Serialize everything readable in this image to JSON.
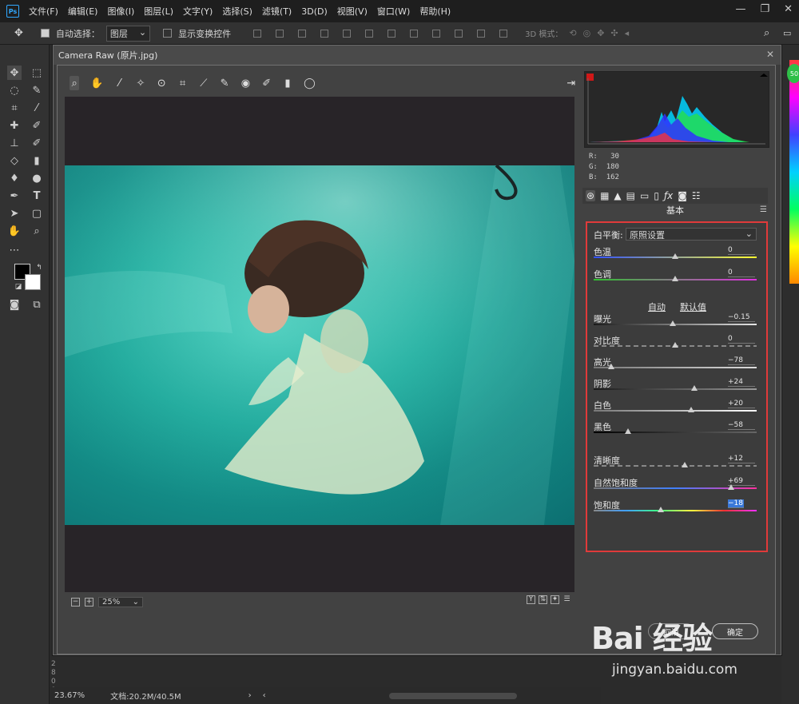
{
  "menubar": {
    "logo": "Ps",
    "items": [
      "文件(F)",
      "编辑(E)",
      "图像(I)",
      "图层(L)",
      "文字(Y)",
      "选择(S)",
      "滤镜(T)",
      "3D(D)",
      "视图(V)",
      "窗口(W)",
      "帮助(H)"
    ],
    "win_ctrls": [
      "—",
      "❐",
      "✕"
    ]
  },
  "options": {
    "auto_select_label": "自动选择：",
    "auto_select_value": "图层",
    "show_transform_label": "显示变换控件",
    "mode_3d_label": "3D 模式："
  },
  "dialog": {
    "title": "Camera Raw (原片.jpg)",
    "close": "✕"
  },
  "zoom": {
    "value": "25%"
  },
  "rgb": {
    "r_label": "R:",
    "r": "30",
    "g_label": "G:",
    "g": "180",
    "b_label": "B:",
    "b": "162"
  },
  "panel": {
    "title": "基本",
    "wb_label": "白平衡:",
    "wb_value": "原照设置",
    "auto": "自动",
    "default": "默认值"
  },
  "sliders": [
    {
      "label": "色温",
      "value": "0",
      "level": 0.5
    },
    {
      "label": "色调",
      "value": "0",
      "level": 0.5
    },
    {
      "label": "曝光",
      "value": "−0.15",
      "level": 0.485
    },
    {
      "label": "对比度",
      "value": "0",
      "level": 0.5
    },
    {
      "label": "高光",
      "value": "−78",
      "level": 0.11
    },
    {
      "label": "阴影",
      "value": "+24",
      "level": 0.62
    },
    {
      "label": "白色",
      "value": "+20",
      "level": 0.6
    },
    {
      "label": "黑色",
      "value": "−58",
      "level": 0.21
    },
    {
      "label": "清晰度",
      "value": "+12",
      "level": 0.56
    },
    {
      "label": "自然饱和度",
      "value": "+69",
      "level": 0.845
    },
    {
      "label": "饱和度",
      "value": "−18",
      "level": 0.41
    }
  ],
  "buttons": {
    "cancel": "取消",
    "ok": "确定"
  },
  "status": {
    "zoom": "23.67%",
    "doc": "文档:20.2M/40.5M"
  },
  "pagenums": [
    "2",
    "8",
    "0",
    "0"
  ],
  "watermark": {
    "main": "Bai 经验",
    "sub": "jingyan.baidu.com"
  },
  "badge": "50"
}
